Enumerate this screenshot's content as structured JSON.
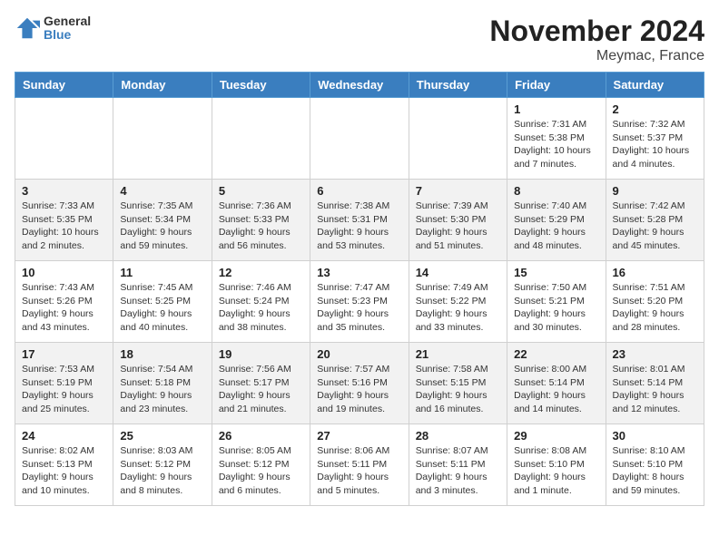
{
  "logo": {
    "general": "General",
    "blue": "Blue"
  },
  "title": "November 2024",
  "location": "Meymac, France",
  "headers": [
    "Sunday",
    "Monday",
    "Tuesday",
    "Wednesday",
    "Thursday",
    "Friday",
    "Saturday"
  ],
  "weeks": [
    [
      {
        "day": "",
        "info": ""
      },
      {
        "day": "",
        "info": ""
      },
      {
        "day": "",
        "info": ""
      },
      {
        "day": "",
        "info": ""
      },
      {
        "day": "",
        "info": ""
      },
      {
        "day": "1",
        "info": "Sunrise: 7:31 AM\nSunset: 5:38 PM\nDaylight: 10 hours\nand 7 minutes."
      },
      {
        "day": "2",
        "info": "Sunrise: 7:32 AM\nSunset: 5:37 PM\nDaylight: 10 hours\nand 4 minutes."
      }
    ],
    [
      {
        "day": "3",
        "info": "Sunrise: 7:33 AM\nSunset: 5:35 PM\nDaylight: 10 hours\nand 2 minutes."
      },
      {
        "day": "4",
        "info": "Sunrise: 7:35 AM\nSunset: 5:34 PM\nDaylight: 9 hours\nand 59 minutes."
      },
      {
        "day": "5",
        "info": "Sunrise: 7:36 AM\nSunset: 5:33 PM\nDaylight: 9 hours\nand 56 minutes."
      },
      {
        "day": "6",
        "info": "Sunrise: 7:38 AM\nSunset: 5:31 PM\nDaylight: 9 hours\nand 53 minutes."
      },
      {
        "day": "7",
        "info": "Sunrise: 7:39 AM\nSunset: 5:30 PM\nDaylight: 9 hours\nand 51 minutes."
      },
      {
        "day": "8",
        "info": "Sunrise: 7:40 AM\nSunset: 5:29 PM\nDaylight: 9 hours\nand 48 minutes."
      },
      {
        "day": "9",
        "info": "Sunrise: 7:42 AM\nSunset: 5:28 PM\nDaylight: 9 hours\nand 45 minutes."
      }
    ],
    [
      {
        "day": "10",
        "info": "Sunrise: 7:43 AM\nSunset: 5:26 PM\nDaylight: 9 hours\nand 43 minutes."
      },
      {
        "day": "11",
        "info": "Sunrise: 7:45 AM\nSunset: 5:25 PM\nDaylight: 9 hours\nand 40 minutes."
      },
      {
        "day": "12",
        "info": "Sunrise: 7:46 AM\nSunset: 5:24 PM\nDaylight: 9 hours\nand 38 minutes."
      },
      {
        "day": "13",
        "info": "Sunrise: 7:47 AM\nSunset: 5:23 PM\nDaylight: 9 hours\nand 35 minutes."
      },
      {
        "day": "14",
        "info": "Sunrise: 7:49 AM\nSunset: 5:22 PM\nDaylight: 9 hours\nand 33 minutes."
      },
      {
        "day": "15",
        "info": "Sunrise: 7:50 AM\nSunset: 5:21 PM\nDaylight: 9 hours\nand 30 minutes."
      },
      {
        "day": "16",
        "info": "Sunrise: 7:51 AM\nSunset: 5:20 PM\nDaylight: 9 hours\nand 28 minutes."
      }
    ],
    [
      {
        "day": "17",
        "info": "Sunrise: 7:53 AM\nSunset: 5:19 PM\nDaylight: 9 hours\nand 25 minutes."
      },
      {
        "day": "18",
        "info": "Sunrise: 7:54 AM\nSunset: 5:18 PM\nDaylight: 9 hours\nand 23 minutes."
      },
      {
        "day": "19",
        "info": "Sunrise: 7:56 AM\nSunset: 5:17 PM\nDaylight: 9 hours\nand 21 minutes."
      },
      {
        "day": "20",
        "info": "Sunrise: 7:57 AM\nSunset: 5:16 PM\nDaylight: 9 hours\nand 19 minutes."
      },
      {
        "day": "21",
        "info": "Sunrise: 7:58 AM\nSunset: 5:15 PM\nDaylight: 9 hours\nand 16 minutes."
      },
      {
        "day": "22",
        "info": "Sunrise: 8:00 AM\nSunset: 5:14 PM\nDaylight: 9 hours\nand 14 minutes."
      },
      {
        "day": "23",
        "info": "Sunrise: 8:01 AM\nSunset: 5:14 PM\nDaylight: 9 hours\nand 12 minutes."
      }
    ],
    [
      {
        "day": "24",
        "info": "Sunrise: 8:02 AM\nSunset: 5:13 PM\nDaylight: 9 hours\nand 10 minutes."
      },
      {
        "day": "25",
        "info": "Sunrise: 8:03 AM\nSunset: 5:12 PM\nDaylight: 9 hours\nand 8 minutes."
      },
      {
        "day": "26",
        "info": "Sunrise: 8:05 AM\nSunset: 5:12 PM\nDaylight: 9 hours\nand 6 minutes."
      },
      {
        "day": "27",
        "info": "Sunrise: 8:06 AM\nSunset: 5:11 PM\nDaylight: 9 hours\nand 5 minutes."
      },
      {
        "day": "28",
        "info": "Sunrise: 8:07 AM\nSunset: 5:11 PM\nDaylight: 9 hours\nand 3 minutes."
      },
      {
        "day": "29",
        "info": "Sunrise: 8:08 AM\nSunset: 5:10 PM\nDaylight: 9 hours\nand 1 minute."
      },
      {
        "day": "30",
        "info": "Sunrise: 8:10 AM\nSunset: 5:10 PM\nDaylight: 8 hours\nand 59 minutes."
      }
    ]
  ]
}
